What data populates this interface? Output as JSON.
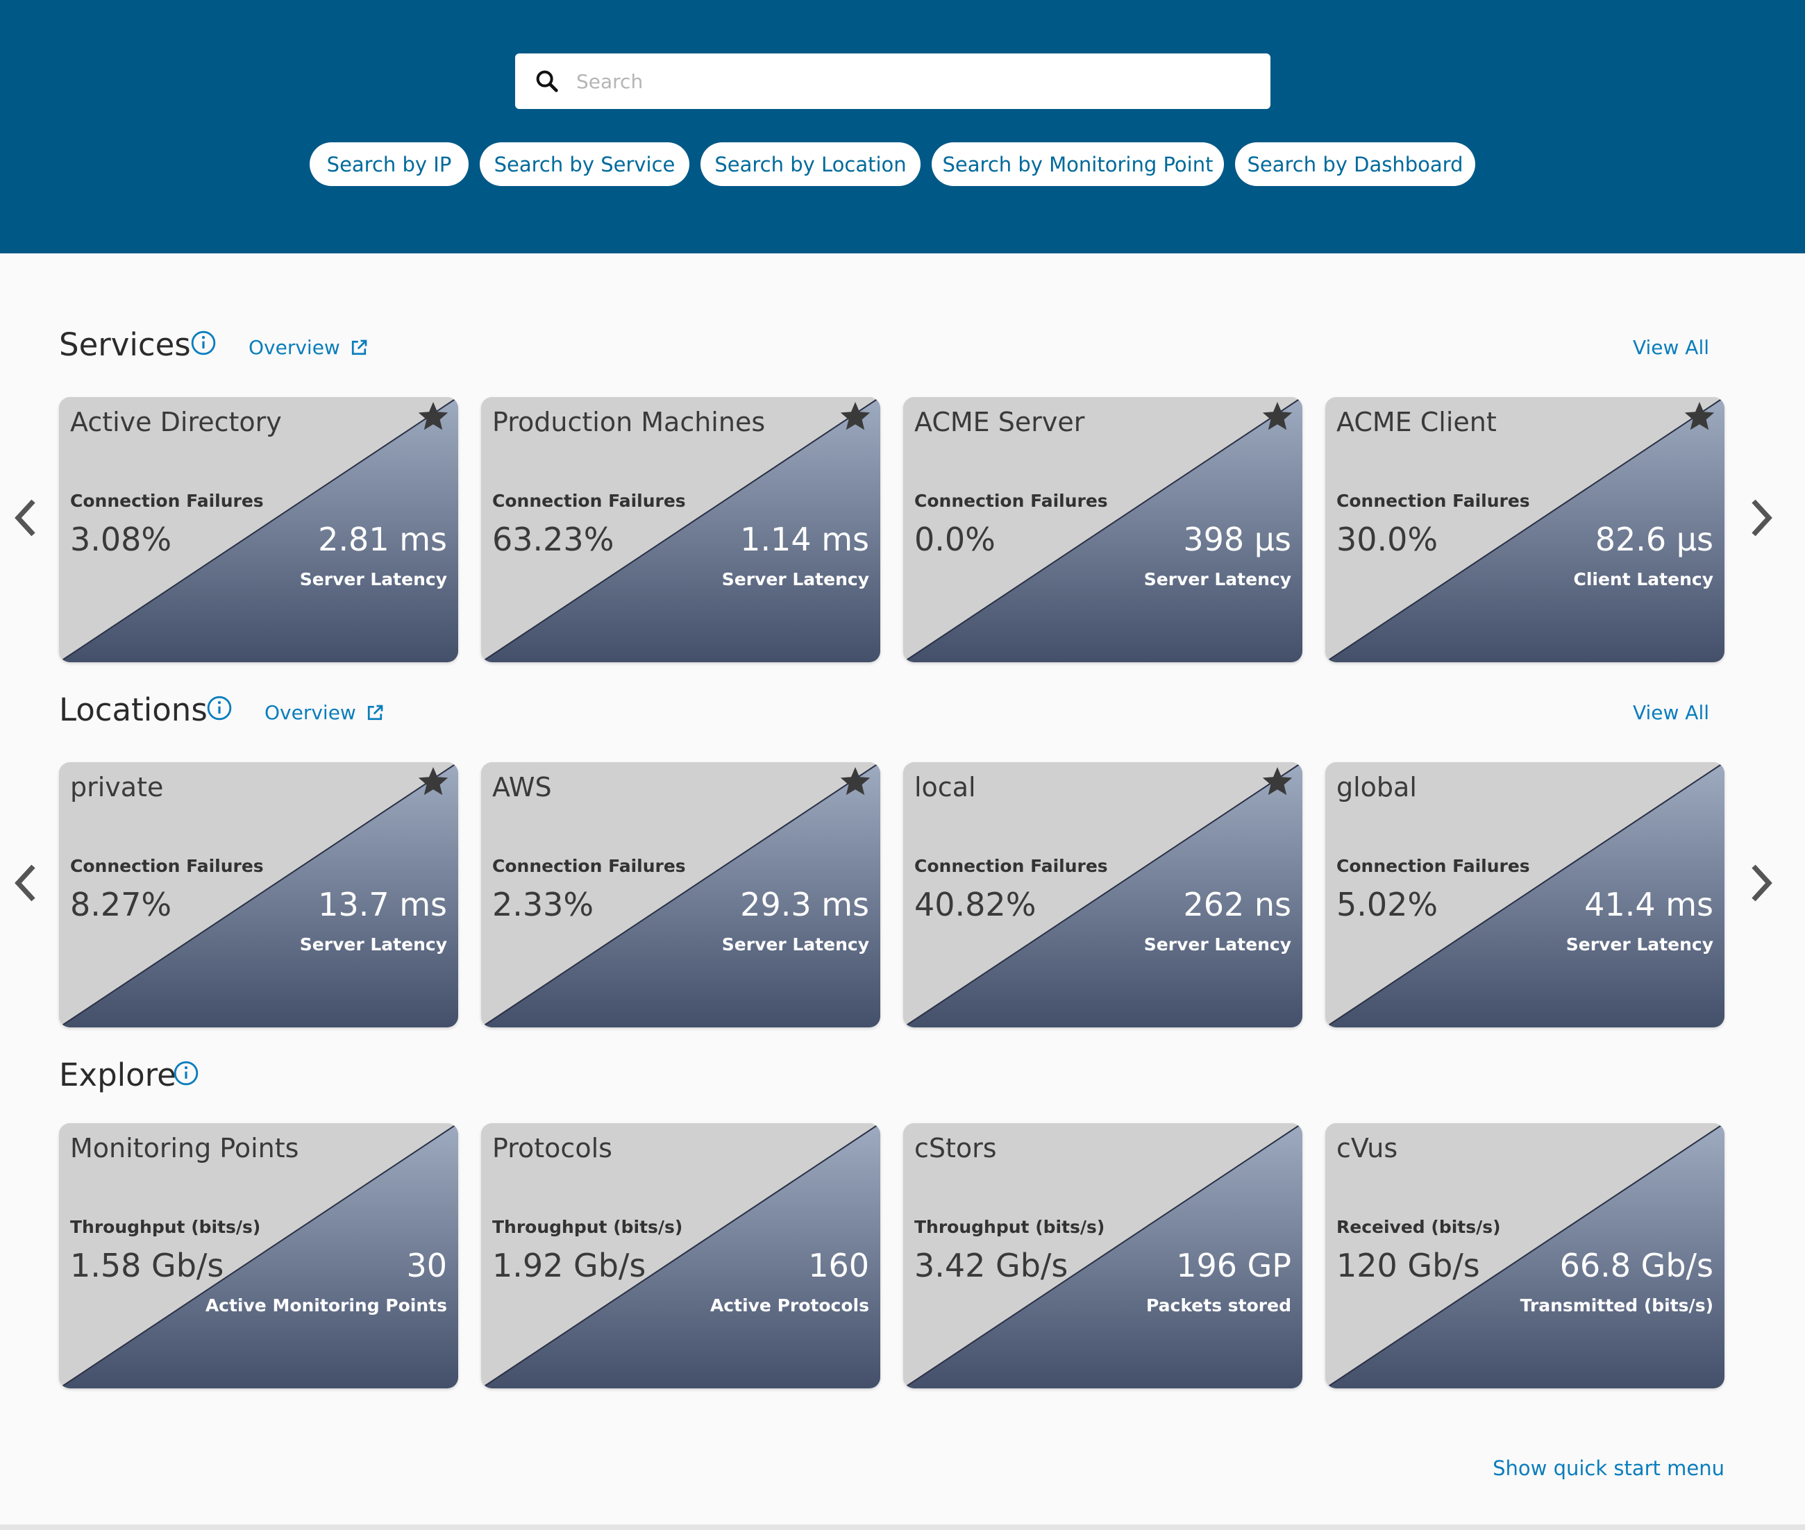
{
  "search": {
    "placeholder": "Search"
  },
  "filters": [
    "Search by IP",
    "Search by Service",
    "Search by Location",
    "Search by Monitoring Point",
    "Search by Dashboard"
  ],
  "services": {
    "title": "Services",
    "overview": "Overview",
    "view_all": "View All",
    "cards": [
      {
        "title": "Active Directory",
        "left_label": "Connection Failures",
        "left_value": "3.08%",
        "right_value": "2.81 ms",
        "right_label": "Server Latency",
        "favorite": true
      },
      {
        "title": "Production Machines",
        "left_label": "Connection Failures",
        "left_value": "63.23%",
        "right_value": "1.14 ms",
        "right_label": "Server Latency",
        "favorite": true
      },
      {
        "title": "ACME Server",
        "left_label": "Connection Failures",
        "left_value": "0.0%",
        "right_value": "398 µs",
        "right_label": "Server Latency",
        "favorite": true
      },
      {
        "title": "ACME Client",
        "left_label": "Connection Failures",
        "left_value": "30.0%",
        "right_value": "82.6 µs",
        "right_label": "Client Latency",
        "favorite": true
      }
    ]
  },
  "locations": {
    "title": "Locations",
    "overview": "Overview",
    "view_all": "View All",
    "cards": [
      {
        "title": "private",
        "left_label": "Connection Failures",
        "left_value": "8.27%",
        "right_value": "13.7 ms",
        "right_label": "Server Latency",
        "favorite": true
      },
      {
        "title": "AWS",
        "left_label": "Connection Failures",
        "left_value": "2.33%",
        "right_value": "29.3 ms",
        "right_label": "Server Latency",
        "favorite": true
      },
      {
        "title": "local",
        "left_label": "Connection Failures",
        "left_value": "40.82%",
        "right_value": "262 ns",
        "right_label": "Server Latency",
        "favorite": true
      },
      {
        "title": "global",
        "left_label": "Connection Failures",
        "left_value": "5.02%",
        "right_value": "41.4 ms",
        "right_label": "Server Latency",
        "favorite": false
      }
    ]
  },
  "explore": {
    "title": "Explore",
    "cards": [
      {
        "title": "Monitoring Points",
        "left_label": "Throughput (bits/s)",
        "left_value": "1.58 Gb/s",
        "right_value": "30",
        "right_label": "Active Monitoring Points"
      },
      {
        "title": "Protocols",
        "left_label": "Throughput (bits/s)",
        "left_value": "1.92 Gb/s",
        "right_value": "160",
        "right_label": "Active Protocols"
      },
      {
        "title": "cStors",
        "left_label": "Throughput (bits/s)",
        "left_value": "3.42 Gb/s",
        "right_value": "196 GP",
        "right_label": "Packets stored"
      },
      {
        "title": "cVus",
        "left_label": "Received (bits/s)",
        "left_value": "120 Gb/s",
        "right_value": "66.8 Gb/s",
        "right_label": "Transmitted (bits/s)"
      }
    ]
  },
  "footer": {
    "quick_start": "Show quick start menu"
  },
  "colors": {
    "header_bg": "#005886",
    "link": "#0a7dbd",
    "card_light": "#d0d0d0",
    "card_gradient_top": "#9eabc0",
    "card_gradient_bottom": "#44506a"
  }
}
